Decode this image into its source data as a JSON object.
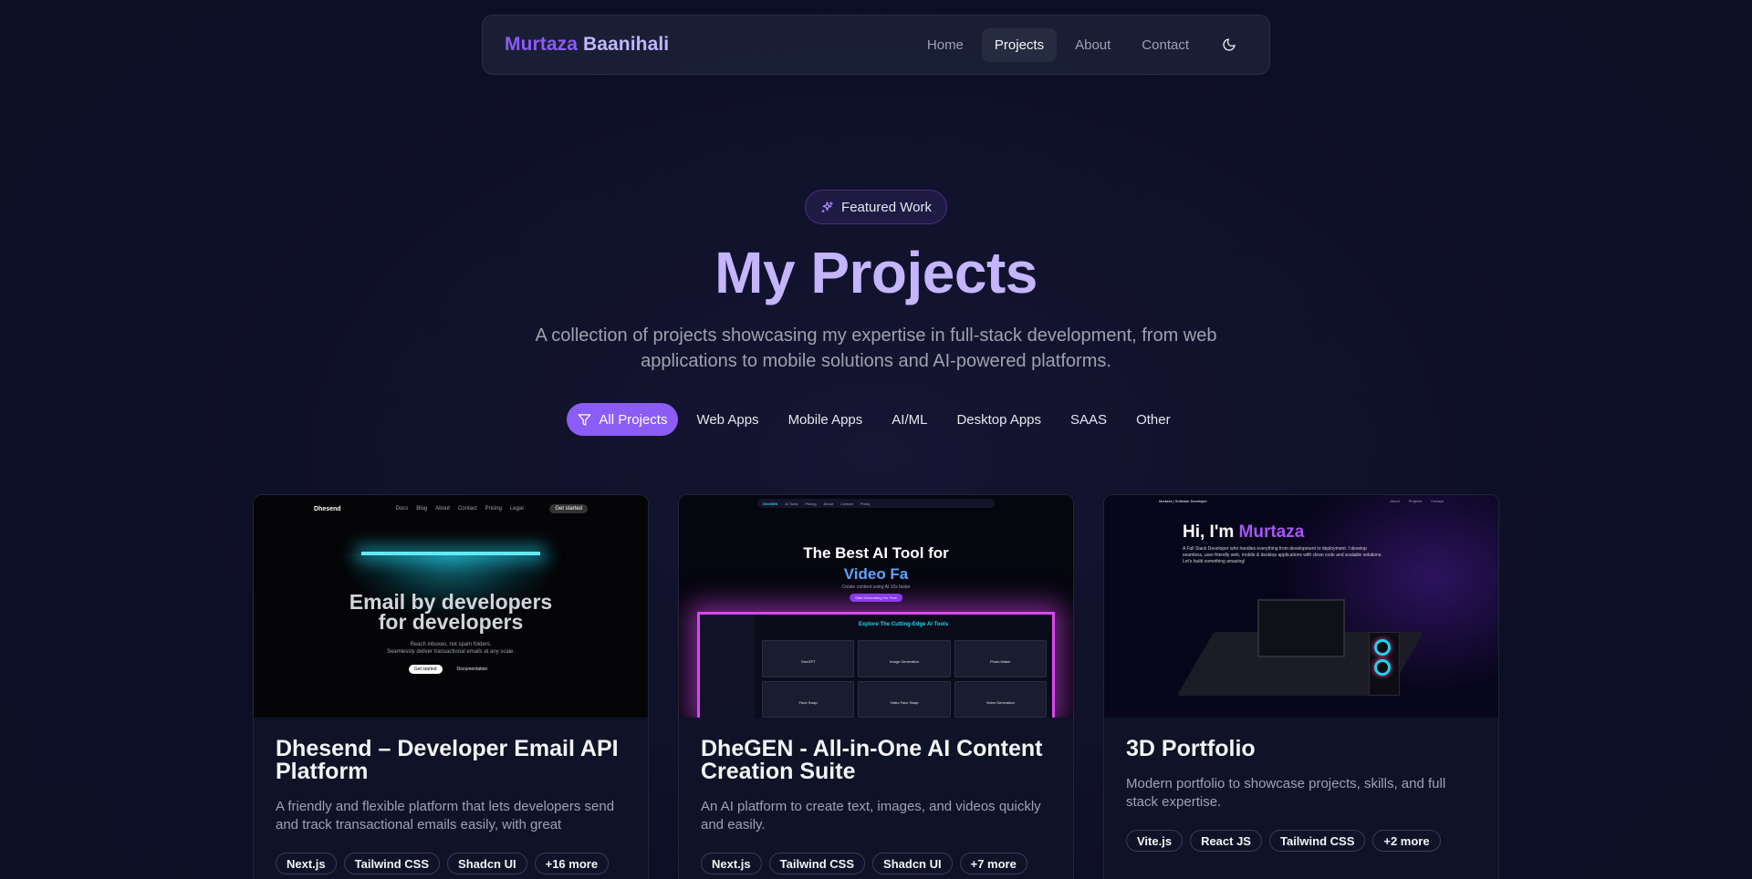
{
  "nav": {
    "brand_first": "Murtaza",
    "brand_last": "Baanihali",
    "links": [
      "Home",
      "Projects",
      "About",
      "Contact"
    ],
    "active": "Projects",
    "theme_icon": "moon-icon"
  },
  "hero": {
    "badge": "Featured Work",
    "badge_icon": "sparkles-icon",
    "title": "My Projects",
    "subtitle": "A collection of projects showcasing my expertise in full-stack development, from web applications to mobile solutions and AI-powered platforms."
  },
  "filters": {
    "icon": "filter-icon",
    "items": [
      "All Projects",
      "Web Apps",
      "Mobile Apps",
      "AI/ML",
      "Desktop Apps",
      "SAAS",
      "Other"
    ],
    "active": "All Projects"
  },
  "projects": [
    {
      "title": "Dhesend – Developer Email API Platform",
      "description": "A friendly and flexible platform that lets developers send and track transactional emails easily, with great features...",
      "tags": [
        "Next.js",
        "Tailwind CSS",
        "Shadcn UI",
        "+16 more"
      ],
      "thumb": {
        "logo": "Dhesend",
        "nav": [
          "Docs",
          "Blog",
          "About",
          "Contact",
          "Pricing",
          "Legal"
        ],
        "cta": "Get started",
        "headline_1": "Email by developers",
        "headline_2": "for developers",
        "tagline_1": "Reach inboxes, not spam folders.",
        "tagline_2": "Seamlessly deliver transactional emails at any scale.",
        "btn_primary": "Get started",
        "btn_secondary": "Documentation"
      }
    },
    {
      "title": "DheGEN - All-in-One AI Content Creation Suite",
      "description": "An AI platform to create text, images, and videos quickly and easily.",
      "tags": [
        "Next.js",
        "Tailwind CSS",
        "Shadcn UI",
        "+7 more"
      ],
      "thumb": {
        "logo": "DheGEN",
        "nav": [
          "AI Tools",
          "Pricing",
          "About",
          "Contact",
          "Policy"
        ],
        "headline_1": "The Best AI Tool for",
        "headline_2": "Video Fa",
        "sub": "Create content using AI 10x faster",
        "cta": "Start Generating For Free",
        "panel_title": "Explore The Cutting-Edge AI Tools",
        "tools": [
          "GenGPT",
          "Image Generation",
          "Photo Maker",
          "Face Swap",
          "Video Face Swap",
          "Video Generation"
        ]
      }
    },
    {
      "title": "3D Portfolio",
      "description": "Modern portfolio to showcase projects, skills, and full stack expertise.",
      "tags": [
        "Vite.js",
        "React JS",
        "Tailwind CSS",
        "+2 more"
      ],
      "thumb": {
        "logo": "Murtaza | Software Developer",
        "nav": [
          "About",
          "Projects",
          "Contact"
        ],
        "hi": "Hi, I'm",
        "name": "Murtaza",
        "intro": "A Full Stack Developer who handles everything from development to deployment. I develop seamless, user-friendly web, mobile & desktop applications with clean code and scalable solutions. Let's build something amazing!"
      }
    }
  ],
  "colors": {
    "accent": "#8b5cf6",
    "title": "#c4b5fd",
    "background": "#0d0f26"
  }
}
